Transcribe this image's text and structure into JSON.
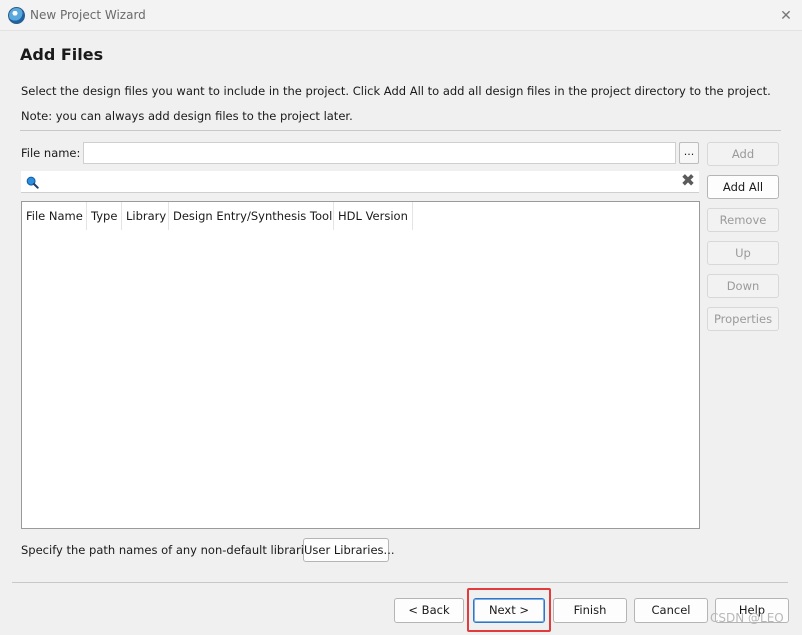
{
  "window": {
    "title": "New Project Wizard"
  },
  "page": {
    "title": "Add Files",
    "description": "Select the design files you want to include in the project. Click Add All to add all design files in the project directory to the project.",
    "note": "Note: you can always add design files to the project later."
  },
  "file_name": {
    "label": "File name:",
    "value": "",
    "browse_label": "..."
  },
  "search": {
    "value": "",
    "placeholder": ""
  },
  "table": {
    "columns": [
      "File Name",
      "Type",
      "Library",
      "Design Entry/Synthesis Tool",
      "HDL Version"
    ],
    "rows": []
  },
  "side_buttons": {
    "add": "Add",
    "add_all": "Add All",
    "remove": "Remove",
    "up": "Up",
    "down": "Down",
    "properties": "Properties"
  },
  "user_libraries": {
    "text": "Specify the path names of any non-default libraries.",
    "button": "User Libraries..."
  },
  "footer": {
    "back": "< Back",
    "next": "Next >",
    "finish": "Finish",
    "cancel": "Cancel",
    "help": "Help"
  },
  "watermark": "CSDN @LEO",
  "colors": {
    "highlight": "#e23b3b",
    "focus": "#2f76c4"
  }
}
